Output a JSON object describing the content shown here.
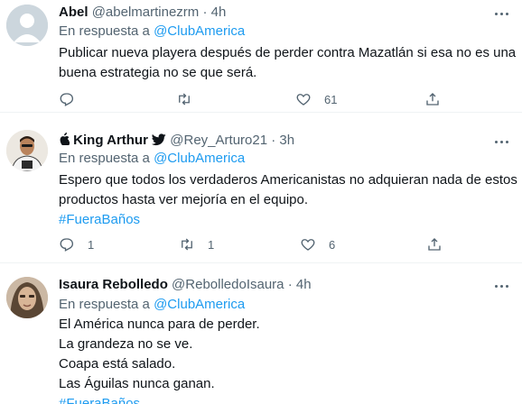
{
  "tweets": [
    {
      "name": "Abel",
      "handle": "@abelmartinezrm",
      "time": "4h",
      "reply_prefix": "En respuesta a",
      "reply_mention": "@ClubAmerica",
      "lines": [
        "Publicar nueva playera después de perder contra Mazatlán si esa no es una",
        "buena estrategia no se que será."
      ],
      "hashtag": "",
      "replies": "",
      "retweets": "",
      "likes": "61"
    },
    {
      "name": "King Arthur",
      "handle": "@Rey_Arturo21",
      "time": "3h",
      "reply_prefix": "En respuesta a",
      "reply_mention": "@ClubAmerica",
      "lines": [
        "Espero que todos los verdaderos Americanistas no adquieran nada de estos",
        "productos hasta ver mejoría en el equipo."
      ],
      "hashtag": "#FueraBaños",
      "replies": "1",
      "retweets": "1",
      "likes": "6"
    },
    {
      "name": "Isaura Rebolledo",
      "handle": "@RebolledoIsaura",
      "time": "4h",
      "reply_prefix": "En respuesta a",
      "reply_mention": "@ClubAmerica",
      "lines": [
        "El América nunca para de perder.",
        "La grandeza no se ve.",
        "Coapa está salado.",
        "Las Águilas nunca ganan."
      ],
      "hashtag": "#FueraBaños"
    }
  ],
  "separator": "·",
  "icons": {
    "reply": "reply-icon",
    "retweet": "retweet-icon",
    "like": "heart-icon",
    "share": "share-icon",
    "more": "more-icon",
    "apple": "apple-icon",
    "twitter": "twitter-bird-icon"
  },
  "colors": {
    "accent": "#1d9bf0",
    "muted": "#536471",
    "text": "#0f1419"
  }
}
